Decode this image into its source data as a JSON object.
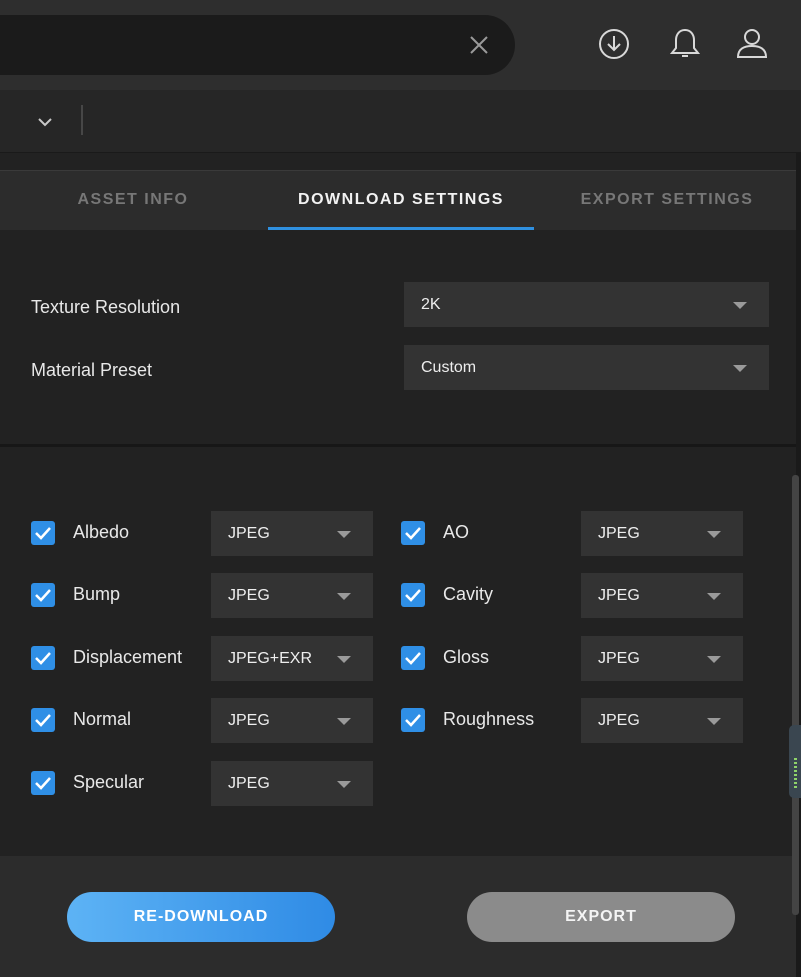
{
  "search": {
    "value": "",
    "placeholder": ""
  },
  "tabs": [
    {
      "label": "ASSET INFO"
    },
    {
      "label": "DOWNLOAD SETTINGS"
    },
    {
      "label": "EXPORT SETTINGS"
    }
  ],
  "settings": {
    "texture_resolution": {
      "label": "Texture Resolution",
      "value": "2K"
    },
    "material_preset": {
      "label": "Material Preset",
      "value": "Custom"
    }
  },
  "maps": [
    {
      "label": "Albedo",
      "format": "JPEG",
      "checked": true
    },
    {
      "label": "AO",
      "format": "JPEG",
      "checked": true
    },
    {
      "label": "Bump",
      "format": "JPEG",
      "checked": true
    },
    {
      "label": "Cavity",
      "format": "JPEG",
      "checked": true
    },
    {
      "label": "Displacement",
      "format": "JPEG+EXR",
      "checked": true
    },
    {
      "label": "Gloss",
      "format": "JPEG",
      "checked": true
    },
    {
      "label": "Normal",
      "format": "JPEG",
      "checked": true
    },
    {
      "label": "Roughness",
      "format": "JPEG",
      "checked": true
    },
    {
      "label": "Specular",
      "format": "JPEG",
      "checked": true
    }
  ],
  "footer": {
    "redownload_label": "RE-DOWNLOAD",
    "export_label": "EXPORT"
  },
  "icons": {
    "clear": "close-icon",
    "downloads": "download-icon",
    "notifications": "bell-icon",
    "account": "user-icon",
    "dropdown": "chevron-down-icon"
  },
  "colors": {
    "accent": "#2f8fe6",
    "background": "#222222",
    "secondary_button": "#8b8b8b"
  }
}
